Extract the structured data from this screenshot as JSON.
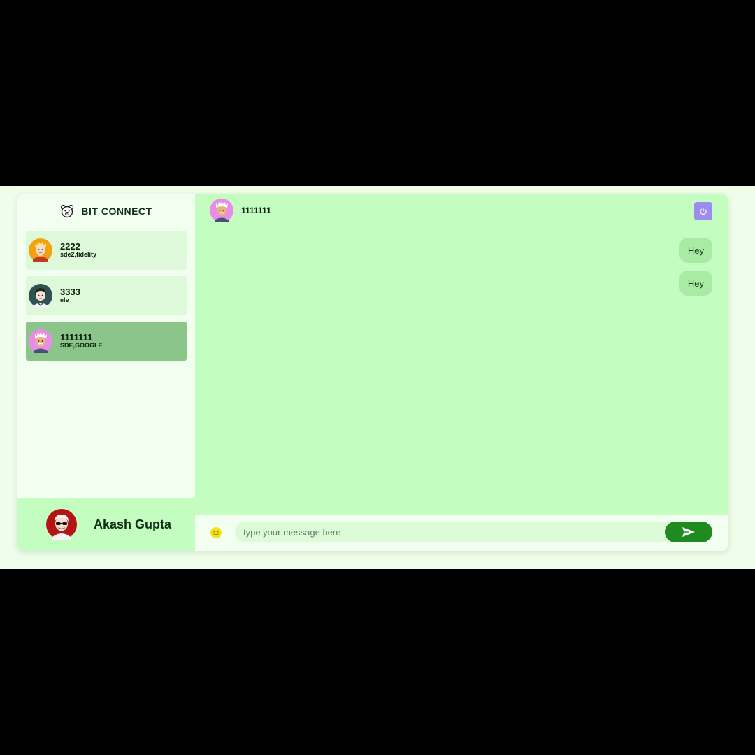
{
  "brand": {
    "title": "BIT CONNECT",
    "logo_icon": "bear-logo-icon"
  },
  "contacts": [
    {
      "name": "2222",
      "subtitle": "sde2,fidelity",
      "avatar": "blonde-person-avatar",
      "active": false
    },
    {
      "name": "3333",
      "subtitle": "ele",
      "avatar": "dark-hair-person-avatar",
      "active": false
    },
    {
      "name": "1111111",
      "subtitle": "SDE,GOOGLE",
      "avatar": "white-hair-person-avatar",
      "active": true
    }
  ],
  "current_user": {
    "name": "Akash Gupta",
    "avatar": "sunglasses-person-avatar"
  },
  "chat": {
    "peer_name": "1111111",
    "peer_avatar": "white-hair-person-avatar",
    "power_icon": "power-icon",
    "messages": [
      {
        "text": "Hey"
      },
      {
        "text": "Hey"
      }
    ]
  },
  "composer": {
    "placeholder": "type your message here",
    "value": "",
    "emoji_icon": "smiley-icon",
    "send_icon": "send-arrow-icon"
  },
  "colors": {
    "page_bg": "#effdeb",
    "chat_bg": "#c3fdbf",
    "active_contact": "#8bc58a",
    "bubble": "#a8eba3",
    "send_button": "#1f8a1f",
    "power_button": "#9c8cf0"
  }
}
